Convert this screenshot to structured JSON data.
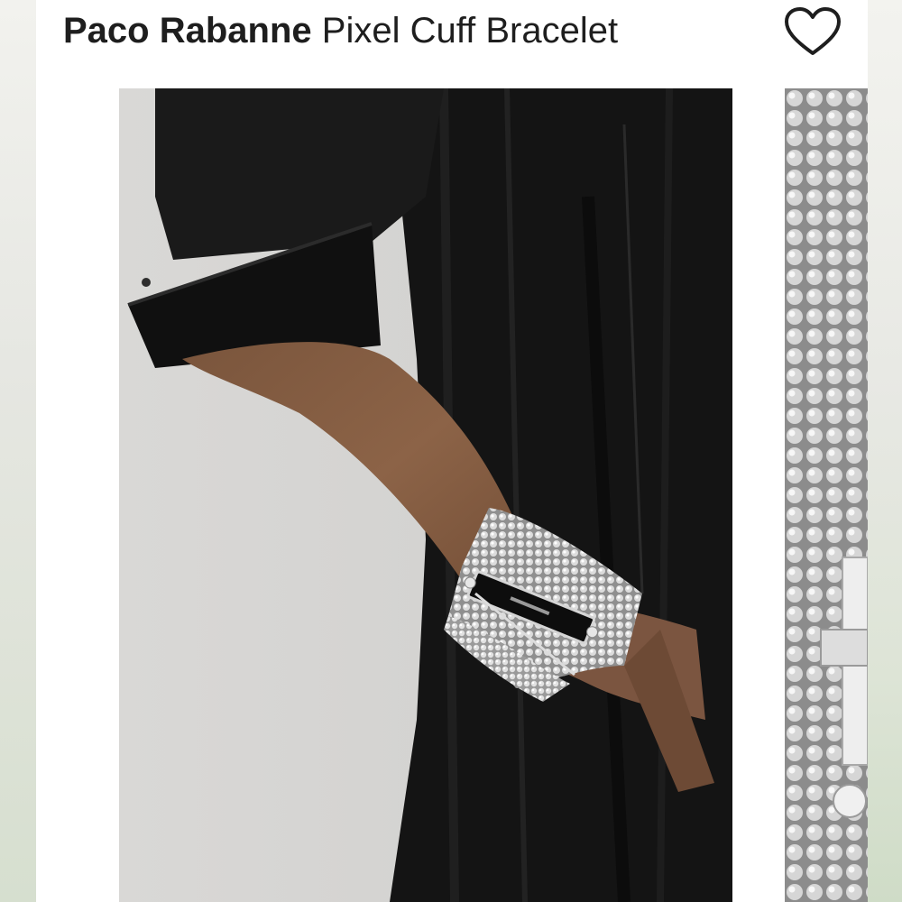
{
  "listing": {
    "brand": "Paco Rabanne",
    "product_name": "Pixel Cuff Bracelet"
  },
  "icons": {
    "like": "heart-outline-icon"
  },
  "gallery": {
    "images": [
      {
        "subject": "model wearing silver chainmail cuff bracelet with black bar, black shirt dress"
      },
      {
        "subject": "close-up of silver chainmail mesh and clasp"
      }
    ]
  },
  "colors": {
    "text": "#1e1e1e",
    "background": "#ffffff",
    "garment": "#151515",
    "metal": "#c9c9c9"
  }
}
